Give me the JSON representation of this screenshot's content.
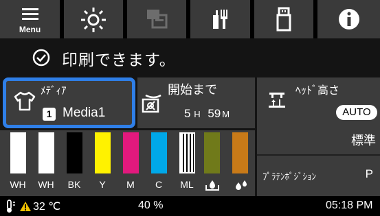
{
  "toolbar": {
    "menu_label": "Menu",
    "buttons": [
      {
        "icon": "menu-icon",
        "label": "Menu"
      },
      {
        "icon": "light-icon"
      },
      {
        "icon": "printer-queue-icon"
      },
      {
        "icon": "maintenance-icon"
      },
      {
        "icon": "usb-icon"
      },
      {
        "icon": "info-icon"
      }
    ]
  },
  "status": {
    "icon": "check-circle-icon",
    "text": "印刷できます。"
  },
  "media": {
    "title": "ﾒﾃﾞｨｱ",
    "number": "1",
    "name": "Media1",
    "highlight_color": "#2f7fe8"
  },
  "drying": {
    "title": "開始まで",
    "time_h": "5",
    "unit_h": "H",
    "time_m": "59",
    "unit_m": "M"
  },
  "head": {
    "title": "ﾍｯﾄﾞ高さ",
    "badge": "AUTO",
    "mode": "標準",
    "platen_label": "ﾌﾟﾗﾃﾝﾎﾟｼﾞｼｮﾝ",
    "platen_value": "P"
  },
  "inks": [
    {
      "label": "WH",
      "color": "#ffffff",
      "level": 1.0
    },
    {
      "label": "WH",
      "color": "#ffffff",
      "level": 1.0
    },
    {
      "label": "BK",
      "color": "#000000",
      "level": 1.0
    },
    {
      "label": "Y",
      "color": "#fff200",
      "level": 1.0
    },
    {
      "label": "M",
      "color": "#e2197d",
      "level": 1.0
    },
    {
      "label": "C",
      "color": "#00a8e8",
      "level": 1.0
    },
    {
      "label": "ML",
      "color": "#ffffff",
      "level": 1.0
    },
    {
      "label": "",
      "icon": "waste-ink-icon",
      "color": "#707a1a",
      "level": 1.0
    },
    {
      "label": "",
      "icon": "cleaning-liquid-icon",
      "color": "#c87a18",
      "level": 1.0
    }
  ],
  "footer": {
    "temp": "32 ℃",
    "humidity": "40 %",
    "time": "05:18 PM"
  }
}
